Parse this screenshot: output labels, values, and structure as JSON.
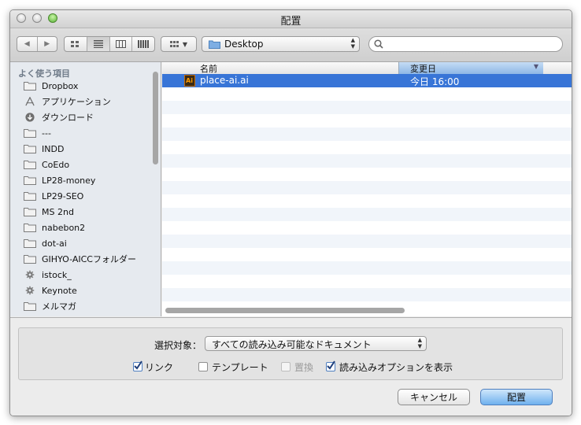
{
  "window": {
    "title": "配置"
  },
  "toolbar": {
    "back_glyph": "◀",
    "forward_glyph": "▶",
    "path_popup_value": "Desktop",
    "search_placeholder": ""
  },
  "sidebar": {
    "heading": "よく使う項目",
    "items": [
      {
        "label": "Dropbox",
        "icon": "folder-icon"
      },
      {
        "label": "アプリケーション",
        "icon": "applications-icon"
      },
      {
        "label": "ダウンロード",
        "icon": "downloads-icon"
      },
      {
        "label": "---",
        "icon": "folder-icon"
      },
      {
        "label": "INDD",
        "icon": "folder-icon"
      },
      {
        "label": "CoEdo",
        "icon": "folder-icon"
      },
      {
        "label": "LP28-money",
        "icon": "folder-icon"
      },
      {
        "label": "LP29-SEO",
        "icon": "folder-icon"
      },
      {
        "label": "MS 2nd",
        "icon": "folder-icon"
      },
      {
        "label": "nabebon2",
        "icon": "folder-icon"
      },
      {
        "label": "dot-ai",
        "icon": "folder-icon"
      },
      {
        "label": "GIHYO-AICCフォルダー",
        "icon": "folder-icon"
      },
      {
        "label": "istock_",
        "icon": "gear-icon"
      },
      {
        "label": "Keynote",
        "icon": "gear-icon"
      },
      {
        "label": "メルマガ",
        "icon": "folder-icon"
      }
    ]
  },
  "filelist": {
    "columns": [
      "名前",
      "変更日"
    ],
    "files": [
      {
        "name": "place-ai.ai",
        "modified": "今日 16:00",
        "icon_text": "Ai"
      }
    ]
  },
  "options": {
    "filter_label": "選択対象：",
    "filter_value": "すべての読み込み可能なドキュメント",
    "checkboxes": [
      {
        "label": "リンク",
        "checked": true
      },
      {
        "label": "テンプレート",
        "checked": false
      },
      {
        "label": "置換",
        "checked": false,
        "disabled": true
      },
      {
        "label": "読み込みオプションを表示",
        "checked": true
      }
    ]
  },
  "buttons": {
    "cancel": "キャンセル",
    "place": "配置"
  },
  "colors": {
    "selection": "#3875d7",
    "sort_header": "#9fc4ed",
    "accent": "#6fb1ee"
  }
}
